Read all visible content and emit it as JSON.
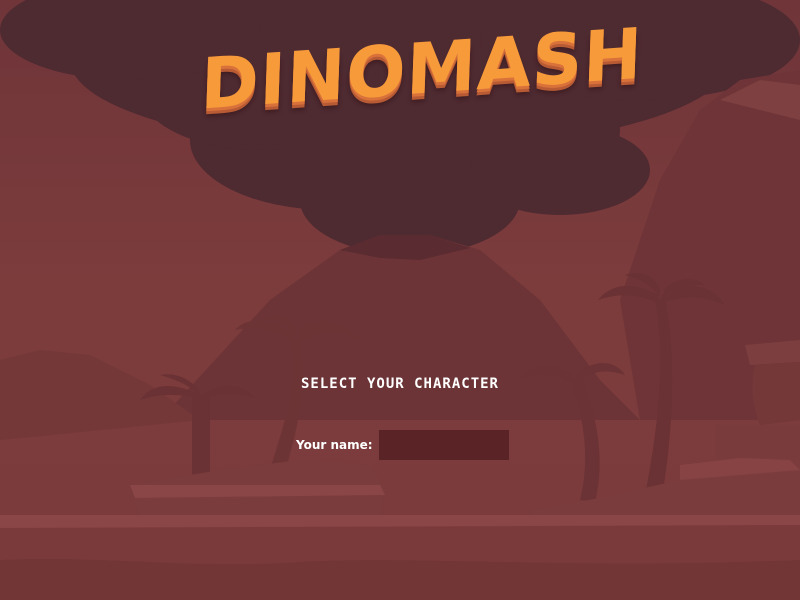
{
  "game": {
    "logo_text": "DINOMASH"
  },
  "character_select": {
    "title": "SELECT YOUR CHARACTER",
    "name_label": "Your name:",
    "name_value": ""
  },
  "colors": {
    "sky": "#7a3a3a",
    "smoke": "#4e2a30",
    "logo": "#f79a3a",
    "input_bg": "#5a2326",
    "text": "#ffffff"
  }
}
